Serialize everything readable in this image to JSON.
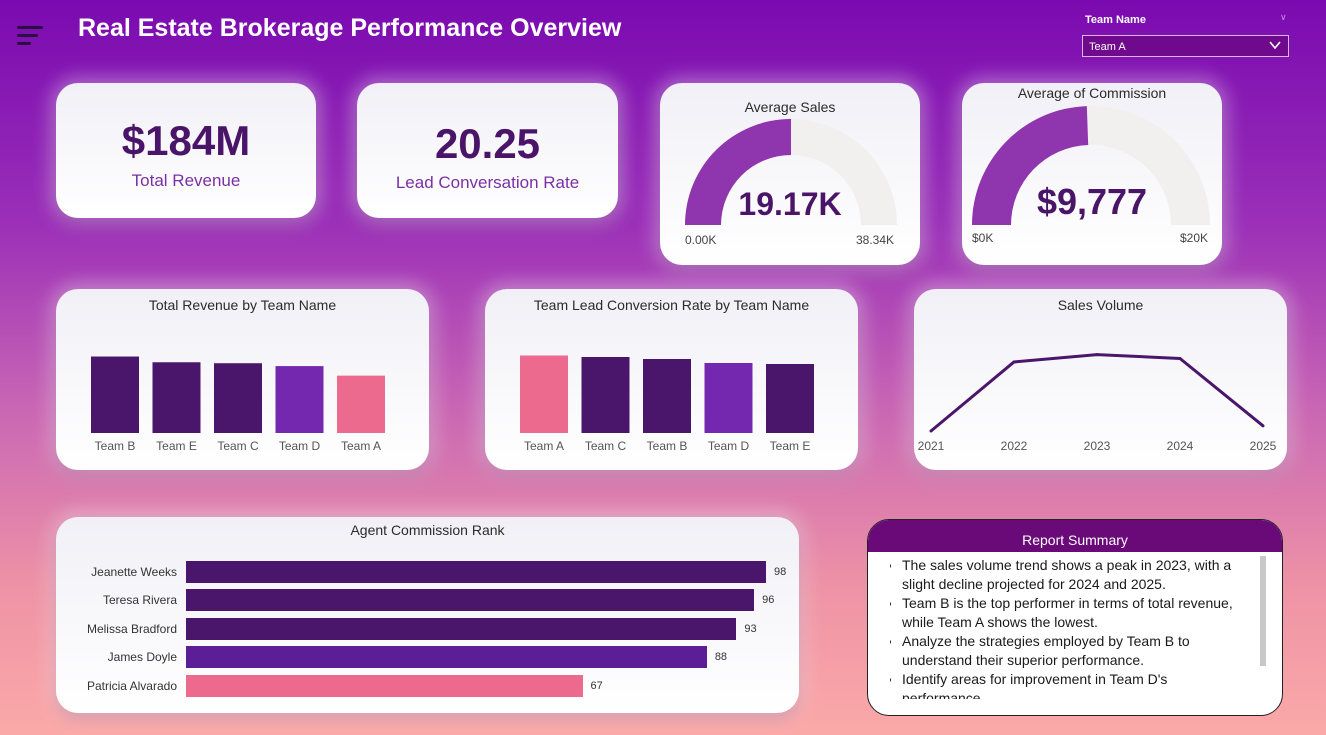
{
  "header": {
    "title": "Real Estate Brokerage Performance Overview",
    "menu_icon": "hamburger-menu-icon",
    "slicer": {
      "label": "Team Name",
      "selected": "Team A"
    }
  },
  "kpis": {
    "total_revenue": {
      "value": "$184M",
      "label": "Total Revenue"
    },
    "lead_rate": {
      "value": "20.25",
      "label": "Lead Conversation Rate"
    }
  },
  "gauges": {
    "average_sales": {
      "title": "Average Sales",
      "value_text": "19.17K",
      "min_label": "0.00K",
      "max_label": "38.34K",
      "value": 19.17,
      "max": 38.34
    },
    "average_commission": {
      "title": "Average of Commission",
      "value_text": "$9,777",
      "min_label": "$0K",
      "max_label": "$20K",
      "value": 9777,
      "max": 20000
    }
  },
  "colors": {
    "dark": "#4a166c",
    "mid": "#7428b0",
    "highlight": "#ec6a8e",
    "gauge_fill": "#8f35ad",
    "gauge_track": "#f1f0ef",
    "line": "#4a166c"
  },
  "chart_data": [
    {
      "type": "bar",
      "title": "Total Revenue by Team Name",
      "categories": [
        "Team B",
        "Team E",
        "Team C",
        "Team D",
        "Team A"
      ],
      "values": [
        40,
        37,
        36.5,
        35,
        30
      ],
      "colors": [
        "#4a166c",
        "#4a166c",
        "#4a166c",
        "#7428b0",
        "#ec6a8e"
      ]
    },
    {
      "type": "bar",
      "title": "Team Lead Conversion Rate by Team Name",
      "categories": [
        "Team A",
        "Team C",
        "Team B",
        "Team D",
        "Team E"
      ],
      "values": [
        20.25,
        20.1,
        19.9,
        19.5,
        19.4
      ],
      "colors": [
        "#ec6a8e",
        "#4a166c",
        "#4a166c",
        "#7428b0",
        "#4a166c"
      ]
    },
    {
      "type": "line",
      "title": "Sales Volume",
      "x": [
        "2021",
        "2022",
        "2023",
        "2024",
        "2025"
      ],
      "values": [
        0,
        160,
        177,
        168,
        12
      ]
    },
    {
      "type": "bar",
      "title": "Agent Commission Rank",
      "orientation": "horizontal",
      "categories": [
        "Jeanette Weeks",
        "Teresa Rivera",
        "Melissa Bradford",
        "James Doyle",
        "Patricia Alvarado"
      ],
      "values": [
        98,
        96,
        93,
        88,
        67
      ],
      "colors": [
        "#4a166c",
        "#4a166c",
        "#4a166c",
        "#5c1e96",
        "#ec6a8e"
      ]
    }
  ],
  "summary": {
    "title": "Report Summary",
    "items": [
      "The sales volume trend shows a peak in 2023, with a slight decline projected for 2024 and 2025.",
      "Team B is the top performer in terms of total revenue, while Team A shows the lowest.",
      "Analyze the strategies employed by Team B to understand their superior performance.",
      "Identify areas for improvement in Team D's performance."
    ]
  }
}
